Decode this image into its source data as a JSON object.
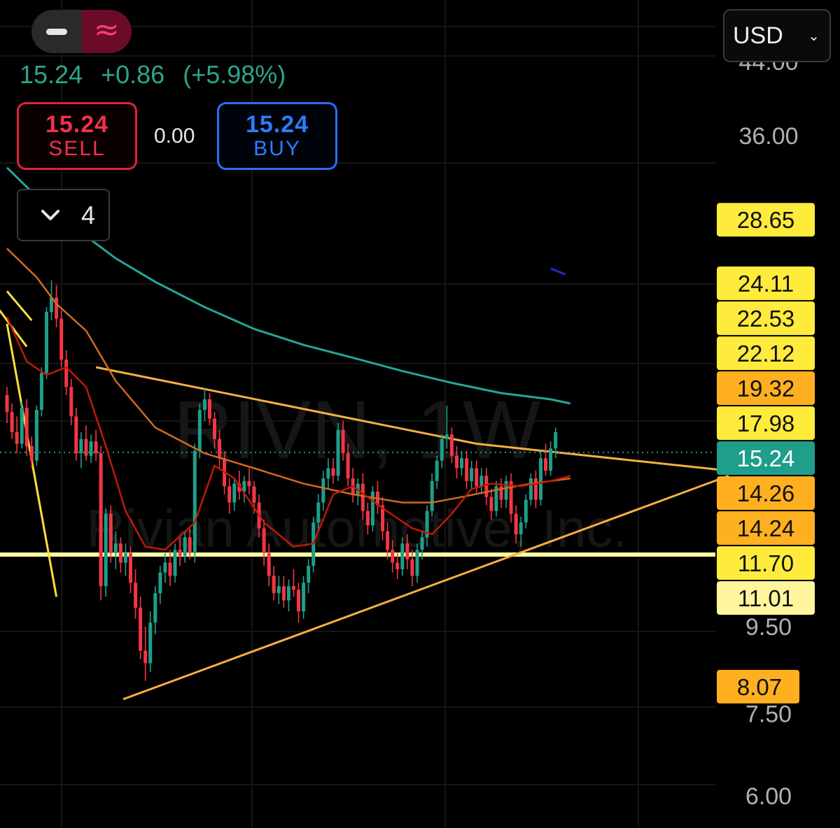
{
  "toolbar": {
    "mode_left_icon": "minus-icon",
    "mode_right_icon": "wave-icon",
    "mode_right_glyph": "≈",
    "last": "15.24",
    "change": "+0.86",
    "change_pct": "(+5.98%)",
    "sell_price": "15.24",
    "sell_label": "SELL",
    "spread": "0.00",
    "buy_price": "15.24",
    "buy_label": "BUY",
    "indicator_icon": "chevron-down-icon",
    "indicator_count": "4",
    "currency": "USD",
    "currency_icon": "chevron-down-icon"
  },
  "chart_data": {
    "type": "candlestick",
    "watermark_symbol": "RIVN, 1W",
    "watermark_name": "Rivian Automotive, Inc.",
    "y_scale": "log",
    "ylim": [
      5.5,
      52
    ],
    "y_ticks": [
      "44.00",
      "36.00",
      "9.50",
      "7.50",
      "6.00"
    ],
    "last_price": 15.24,
    "price_tags": [
      {
        "label": "28.65",
        "value": 28.65,
        "color": "#ffeb3b"
      },
      {
        "label": "24.11",
        "value": 24.11,
        "color": "#ffeb3b"
      },
      {
        "label": "22.53",
        "value": 22.53,
        "color": "#ffeb3b"
      },
      {
        "label": "22.12",
        "value": 22.12,
        "color": "#ffeb3b"
      },
      {
        "label": "19.32",
        "value": 19.32,
        "color": "#ffb020"
      },
      {
        "label": "17.98",
        "value": 17.98,
        "color": "#ffeb3b"
      },
      {
        "label": "15.24",
        "value": 15.24,
        "color": "#1f9e89",
        "text_color": "#ffffff"
      },
      {
        "label": "14.26",
        "value": 14.26,
        "color": "#ffb020"
      },
      {
        "label": "14.24",
        "value": 14.24,
        "color": "#ffb020"
      },
      {
        "label": "11.70",
        "value": 11.7,
        "color": "#ffeb3b"
      },
      {
        "label": "11.01",
        "value": 11.01,
        "color": "#fff59d"
      },
      {
        "label": "8.07",
        "value": 8.07,
        "color": "#ffb020"
      }
    ],
    "colors": {
      "up": "#1f9e89",
      "down": "#f23645",
      "ma_teal": "#26a69a",
      "ma_orange": "#d2691e",
      "ma_red": "#c0180a",
      "trendline": "#f5b042",
      "support": "#ffffa0",
      "fib": "#ffe03a"
    },
    "support_level": 11.55,
    "candles": [
      [
        17.8,
        18.2,
        16.5,
        17.0
      ],
      [
        17.0,
        17.4,
        15.8,
        16.1
      ],
      [
        16.1,
        16.8,
        15.2,
        15.6
      ],
      [
        15.6,
        17.5,
        15.4,
        17.2
      ],
      [
        17.2,
        17.6,
        15.1,
        15.5
      ],
      [
        15.5,
        15.9,
        14.6,
        14.9
      ],
      [
        14.9,
        17.3,
        14.7,
        17.1
      ],
      [
        17.1,
        19.2,
        16.8,
        18.9
      ],
      [
        18.9,
        22.6,
        18.6,
        22.3
      ],
      [
        22.3,
        24.3,
        21.8,
        23.2
      ],
      [
        23.2,
        24.0,
        21.4,
        21.9
      ],
      [
        21.9,
        22.4,
        19.2,
        19.6
      ],
      [
        19.6,
        20.1,
        17.8,
        18.2
      ],
      [
        18.2,
        18.6,
        16.4,
        16.8
      ],
      [
        16.8,
        17.2,
        14.9,
        15.2
      ],
      [
        15.2,
        16.1,
        14.6,
        15.8
      ],
      [
        15.8,
        16.4,
        14.9,
        15.1
      ],
      [
        15.1,
        16.0,
        14.8,
        15.7
      ],
      [
        15.7,
        16.2,
        14.9,
        15.2
      ],
      [
        15.2,
        15.5,
        10.2,
        10.6
      ],
      [
        10.6,
        13.1,
        10.3,
        12.9
      ],
      [
        12.9,
        13.2,
        11.3,
        11.6
      ],
      [
        11.6,
        12.3,
        11.1,
        11.9
      ],
      [
        11.9,
        12.1,
        11.0,
        11.3
      ],
      [
        11.3,
        11.9,
        10.9,
        11.6
      ],
      [
        11.6,
        11.8,
        10.4,
        10.7
      ],
      [
        10.7,
        11.1,
        9.7,
        10.0
      ],
      [
        10.0,
        10.3,
        8.7,
        8.9
      ],
      [
        8.9,
        9.5,
        8.2,
        8.6
      ],
      [
        8.6,
        9.9,
        8.4,
        9.6
      ],
      [
        9.6,
        10.6,
        9.3,
        10.4
      ],
      [
        10.4,
        11.2,
        10.1,
        11.0
      ],
      [
        11.0,
        11.6,
        10.7,
        11.3
      ],
      [
        11.3,
        11.7,
        10.6,
        10.9
      ],
      [
        10.9,
        11.9,
        10.7,
        11.7
      ],
      [
        11.7,
        12.1,
        11.2,
        11.5
      ],
      [
        11.5,
        12.3,
        11.3,
        12.1
      ],
      [
        12.1,
        12.4,
        11.4,
        11.6
      ],
      [
        11.6,
        15.6,
        11.3,
        15.3
      ],
      [
        15.3,
        17.4,
        15.0,
        17.1
      ],
      [
        17.1,
        18.1,
        16.6,
        17.6
      ],
      [
        17.6,
        17.9,
        16.4,
        16.7
      ],
      [
        16.7,
        17.0,
        15.4,
        15.8
      ],
      [
        15.8,
        16.2,
        14.6,
        15.0
      ],
      [
        15.0,
        15.3,
        13.6,
        13.9
      ],
      [
        13.9,
        14.2,
        12.9,
        13.3
      ],
      [
        13.3,
        14.2,
        13.0,
        14.0
      ],
      [
        14.0,
        14.5,
        13.4,
        13.7
      ],
      [
        13.7,
        14.3,
        13.3,
        14.1
      ],
      [
        14.1,
        14.6,
        13.6,
        13.9
      ],
      [
        13.9,
        14.1,
        12.9,
        13.3
      ],
      [
        13.3,
        13.6,
        12.1,
        12.4
      ],
      [
        12.4,
        12.7,
        11.2,
        11.6
      ],
      [
        11.6,
        11.9,
        10.6,
        10.9
      ],
      [
        10.9,
        11.2,
        10.2,
        10.4
      ],
      [
        10.4,
        10.9,
        10.1,
        10.6
      ],
      [
        10.6,
        10.9,
        10.0,
        10.2
      ],
      [
        10.2,
        10.8,
        9.9,
        10.6
      ],
      [
        10.6,
        11.1,
        10.3,
        10.5
      ],
      [
        10.5,
        10.7,
        9.6,
        9.9
      ],
      [
        9.9,
        10.9,
        9.7,
        10.7
      ],
      [
        10.7,
        11.4,
        10.4,
        11.2
      ],
      [
        11.2,
        12.8,
        11.0,
        12.6
      ],
      [
        12.6,
        13.6,
        12.3,
        13.3
      ],
      [
        13.3,
        14.5,
        13.0,
        14.2
      ],
      [
        14.2,
        15.0,
        13.8,
        14.6
      ],
      [
        14.6,
        15.0,
        14.0,
        14.3
      ],
      [
        14.3,
        16.5,
        14.1,
        16.2
      ],
      [
        16.2,
        16.6,
        14.9,
        15.2
      ],
      [
        15.2,
        15.6,
        13.9,
        14.2
      ],
      [
        14.2,
        14.6,
        13.3,
        13.6
      ],
      [
        13.6,
        14.2,
        13.2,
        14.0
      ],
      [
        14.0,
        14.4,
        12.7,
        13.0
      ],
      [
        13.0,
        13.3,
        12.2,
        12.5
      ],
      [
        12.5,
        13.9,
        12.3,
        13.7
      ],
      [
        13.7,
        14.1,
        12.9,
        13.2
      ],
      [
        13.2,
        13.5,
        12.0,
        12.3
      ],
      [
        12.3,
        12.6,
        11.4,
        11.7
      ],
      [
        11.7,
        12.0,
        11.0,
        11.3
      ],
      [
        11.3,
        11.6,
        10.8,
        11.1
      ],
      [
        11.1,
        12.1,
        10.9,
        11.9
      ],
      [
        11.9,
        12.2,
        11.1,
        11.4
      ],
      [
        11.4,
        11.7,
        10.6,
        10.9
      ],
      [
        10.9,
        11.9,
        10.7,
        11.7
      ],
      [
        11.7,
        12.3,
        11.4,
        12.1
      ],
      [
        12.1,
        13.2,
        11.8,
        13.0
      ],
      [
        13.0,
        14.4,
        12.8,
        14.1
      ],
      [
        14.1,
        15.1,
        13.8,
        14.9
      ],
      [
        14.9,
        16.0,
        14.6,
        15.8
      ],
      [
        15.8,
        17.3,
        15.4,
        16.0
      ],
      [
        16.0,
        16.3,
        14.8,
        15.1
      ],
      [
        15.1,
        15.5,
        14.2,
        14.6
      ],
      [
        14.6,
        15.3,
        14.3,
        15.0
      ],
      [
        15.0,
        15.3,
        13.8,
        14.1
      ],
      [
        14.1,
        14.9,
        13.8,
        14.6
      ],
      [
        14.6,
        14.9,
        13.6,
        13.9
      ],
      [
        13.9,
        14.6,
        13.6,
        14.3
      ],
      [
        14.3,
        14.6,
        13.2,
        13.5
      ],
      [
        13.5,
        13.8,
        12.7,
        13.0
      ],
      [
        13.0,
        14.1,
        12.8,
        13.9
      ],
      [
        13.9,
        14.2,
        13.1,
        13.4
      ],
      [
        13.4,
        14.3,
        13.1,
        14.1
      ],
      [
        14.1,
        14.4,
        12.6,
        12.9
      ],
      [
        12.9,
        13.2,
        11.9,
        12.2
      ],
      [
        12.2,
        12.8,
        11.8,
        12.6
      ],
      [
        12.6,
        13.6,
        12.4,
        13.4
      ],
      [
        13.4,
        14.4,
        13.2,
        14.2
      ],
      [
        14.2,
        14.5,
        13.1,
        13.4
      ],
      [
        13.4,
        15.3,
        13.2,
        15.0
      ],
      [
        15.0,
        15.6,
        14.3,
        14.5
      ],
      [
        14.5,
        15.7,
        14.3,
        15.4
      ],
      [
        15.4,
        16.3,
        15.0,
        16.1
      ]
    ],
    "ma_teal": [
      [
        0,
        33.0
      ],
      [
        6,
        30.5
      ],
      [
        12,
        28.6
      ],
      [
        16,
        27.4
      ],
      [
        22,
        25.8
      ],
      [
        30,
        24.2
      ],
      [
        40,
        22.6
      ],
      [
        50,
        21.3
      ],
      [
        60,
        20.4
      ],
      [
        70,
        19.7
      ],
      [
        80,
        19.0
      ],
      [
        90,
        18.4
      ],
      [
        100,
        17.9
      ],
      [
        110,
        17.6
      ],
      [
        114,
        17.4
      ]
    ],
    "ma_orange": [
      [
        0,
        26.5
      ],
      [
        6,
        24.5
      ],
      [
        10,
        22.8
      ],
      [
        16,
        21.2
      ],
      [
        22,
        18.5
      ],
      [
        30,
        16.3
      ],
      [
        40,
        15.2
      ],
      [
        50,
        14.6
      ],
      [
        60,
        14.0
      ],
      [
        70,
        13.6
      ],
      [
        80,
        13.3
      ],
      [
        86,
        13.3
      ],
      [
        92,
        13.5
      ],
      [
        100,
        13.8
      ],
      [
        106,
        14.0
      ],
      [
        114,
        14.2
      ]
    ],
    "ma_red": [
      [
        0,
        22.0
      ],
      [
        4,
        19.5
      ],
      [
        8,
        18.8
      ],
      [
        12,
        19.2
      ],
      [
        16,
        18.2
      ],
      [
        20,
        15.5
      ],
      [
        24,
        13.0
      ],
      [
        28,
        11.8
      ],
      [
        32,
        11.7
      ],
      [
        38,
        12.6
      ],
      [
        42,
        14.7
      ],
      [
        46,
        14.2
      ],
      [
        52,
        12.6
      ],
      [
        58,
        11.8
      ],
      [
        62,
        11.9
      ],
      [
        66,
        13.6
      ],
      [
        70,
        13.9
      ],
      [
        76,
        13.1
      ],
      [
        82,
        12.4
      ],
      [
        86,
        12.2
      ],
      [
        90,
        12.9
      ],
      [
        94,
        13.8
      ],
      [
        98,
        14.0
      ],
      [
        104,
        13.9
      ],
      [
        110,
        14.1
      ],
      [
        114,
        14.3
      ]
    ],
    "trend_upper": [
      [
        18,
        19.2
      ],
      [
        95,
        15.6
      ],
      [
        146,
        14.5
      ]
    ],
    "trend_lower": [
      [
        23.5,
        7.8
      ],
      [
        146,
        14.3
      ]
    ],
    "fib_lines": [
      [
        [
          0,
          23.6
        ],
        [
          5,
          21.8
        ]
      ],
      [
        [
          0,
          21.6
        ],
        [
          10,
          10.3
        ]
      ],
      [
        [
          -2,
          22.6
        ],
        [
          4,
          20.3
        ]
      ]
    ],
    "blue_mark": [
      [
        110,
        25.1
      ],
      [
        113,
        24.7
      ]
    ]
  }
}
